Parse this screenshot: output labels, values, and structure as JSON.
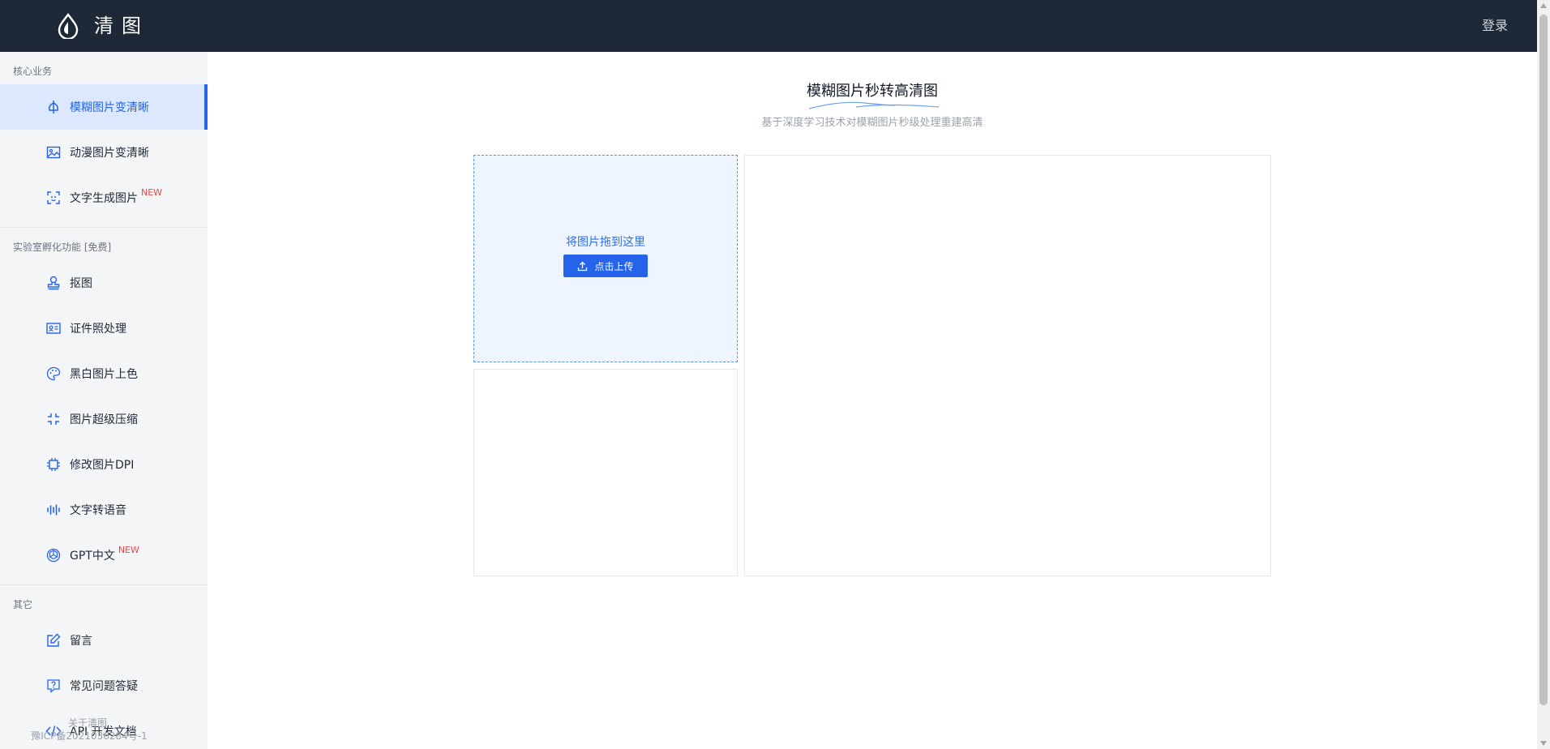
{
  "header": {
    "logo_icon": "drop-logo-icon",
    "brand": "清图",
    "login": "登录"
  },
  "sidebar": {
    "groups": [
      {
        "title": "核心业务",
        "items": [
          {
            "label": "模糊图片变清晰",
            "icon": "sharpen-icon",
            "active": true
          },
          {
            "label": "动漫图片变清晰",
            "icon": "image-icon"
          },
          {
            "label": "文字生成图片",
            "icon": "scan-frame-icon",
            "badge": "NEW"
          }
        ]
      },
      {
        "title": "实验室孵化功能 [免费]",
        "items": [
          {
            "label": "抠图",
            "icon": "stamp-icon"
          },
          {
            "label": "证件照处理",
            "icon": "id-card-icon"
          },
          {
            "label": "黑白图片上色",
            "icon": "palette-icon"
          },
          {
            "label": "图片超级压缩",
            "icon": "shrink-icon"
          },
          {
            "label": "修改图片DPI",
            "icon": "chip-icon"
          },
          {
            "label": "文字转语音",
            "icon": "audio-wave-icon"
          },
          {
            "label": "GPT中文",
            "icon": "openai-icon",
            "badge": "NEW"
          }
        ]
      },
      {
        "title": "其它",
        "items": [
          {
            "label": "留言",
            "icon": "edit-icon"
          },
          {
            "label": "常见问题答疑",
            "icon": "question-icon"
          },
          {
            "label": "API 开发文档",
            "icon": "code-icon"
          }
        ]
      }
    ],
    "footer": {
      "about": "关于清图",
      "icp": "豫ICP备2021036284号-1"
    }
  },
  "main": {
    "title": "模糊图片秒转高清图",
    "subtitle": "基于深度学习技术对模糊图片秒级处理重建高清",
    "upload": {
      "drop_text": "将图片拖到这里",
      "button_label": "点击上传",
      "button_icon": "upload-icon"
    }
  },
  "colors": {
    "topbar": "#1f2837",
    "accent": "#2563eb",
    "sidebar_bg": "#f4f5f7",
    "active_bg": "#dbe8fd",
    "badge": "#ef4444"
  }
}
